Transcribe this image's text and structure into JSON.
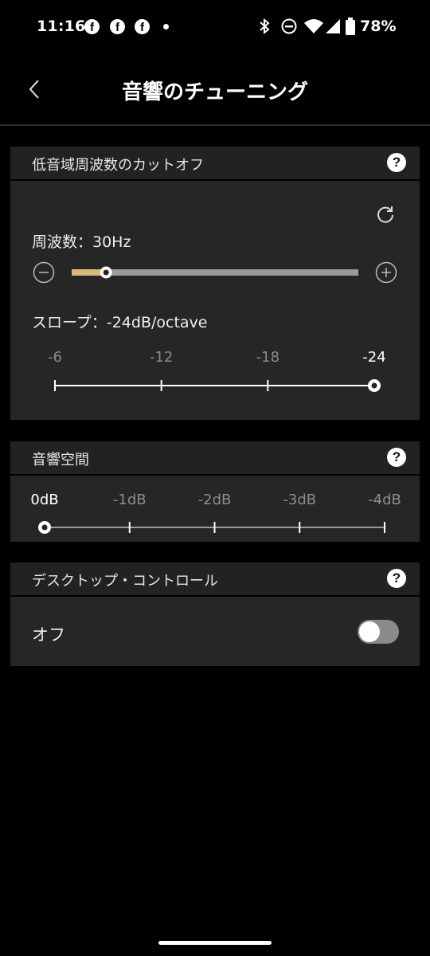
{
  "status_bar": {
    "time": "11:16",
    "notification_icons": [
      "facebook-icon",
      "facebook-icon",
      "facebook-icon"
    ],
    "battery": "78%"
  },
  "header": {
    "title": "音響のチューニング",
    "back_icon": "chevron-left-icon"
  },
  "bass_cutoff": {
    "title": "低音域周波数のカットオフ",
    "frequency_label": "周波数：30Hz",
    "frequency_slider_fraction": 0.12,
    "slope_label": "スロープ：-24dB/octave",
    "slope_ticks": [
      "-6",
      "-12",
      "-18",
      "-24"
    ],
    "slope_selected_index": 3
  },
  "sound_space": {
    "title": "音響空間",
    "ticks": [
      "0dB",
      "-1dB",
      "-2dB",
      "-3dB",
      "-4dB"
    ],
    "selected_index": 0
  },
  "desktop_control": {
    "title": "デスクトップ・コントロール",
    "value_label": "オフ",
    "enabled": false
  },
  "colors": {
    "accent": "#d9b87a",
    "track": "#9a9a9a",
    "section_header": "#222222",
    "section_body": "#262626"
  }
}
